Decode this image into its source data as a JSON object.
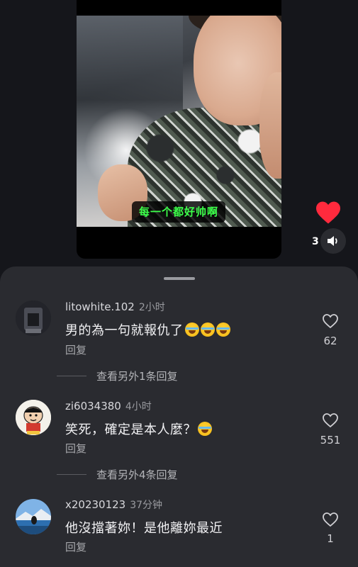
{
  "video": {
    "caption": "每一个都好帅啊",
    "like_count": "3"
  },
  "colors": {
    "accent_red": "#ff2a3d",
    "caption_green": "#3cff4a",
    "sheet_bg": "#2a2b30"
  },
  "comments": [
    {
      "username": "litowhite.102",
      "time": "2小时",
      "text": "男的為一句就報仇了",
      "emoji_count": 3,
      "reply_label": "回复",
      "likes": "62",
      "view_more": "查看另外1条回复"
    },
    {
      "username": "zi6034380",
      "time": "4小时",
      "text": "笑死，確定是本人麼？",
      "emoji_count": 1,
      "reply_label": "回复",
      "likes": "551",
      "view_more": "查看另外4条回复"
    },
    {
      "username": "x20230123",
      "time": "37分钟",
      "text": "他沒擋著妳！是他離妳最近",
      "emoji_count": 0,
      "reply_label": "回复",
      "likes": "1"
    }
  ]
}
